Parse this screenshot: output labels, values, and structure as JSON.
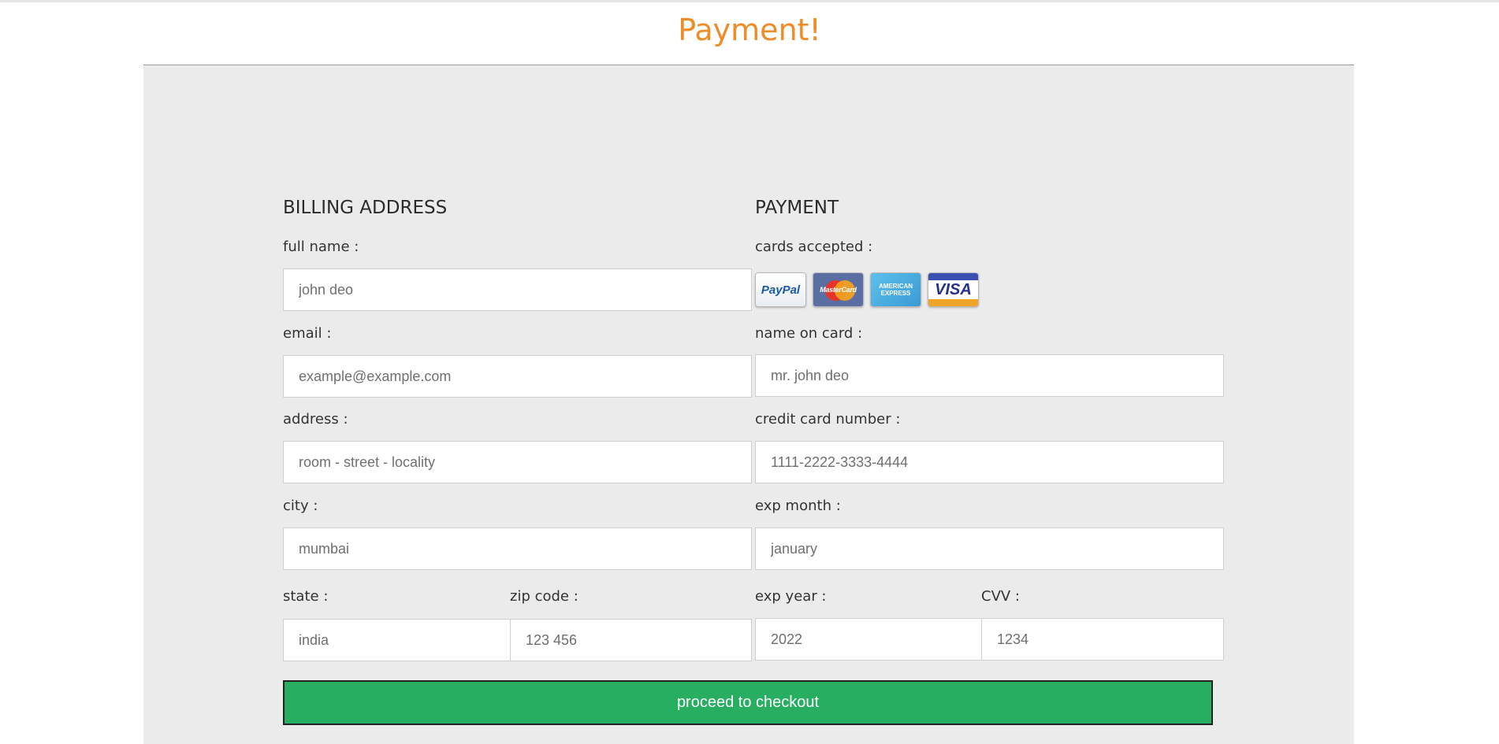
{
  "page": {
    "title": "Payment!"
  },
  "billing": {
    "heading": "BILLING ADDRESS",
    "full_name": {
      "label": "full name :",
      "placeholder": "john deo"
    },
    "email": {
      "label": "email :",
      "placeholder": "example@example.com"
    },
    "address": {
      "label": "address :",
      "placeholder": "room - street - locality"
    },
    "city": {
      "label": "city :",
      "placeholder": "mumbai"
    },
    "state": {
      "label": "state :",
      "placeholder": "india"
    },
    "zip": {
      "label": "zip code :",
      "placeholder": "123 456"
    }
  },
  "payment": {
    "heading": "PAYMENT",
    "cards_label": "cards accepted :",
    "cards": [
      {
        "name": "paypal",
        "text": "PayPal"
      },
      {
        "name": "mastercard",
        "text": "MasterCard"
      },
      {
        "name": "american-express",
        "text": "AMERICAN EXPRESS"
      },
      {
        "name": "visa",
        "text": "VISA"
      }
    ],
    "name_on_card": {
      "label": "name on card :",
      "placeholder": "mr. john deo"
    },
    "card_number": {
      "label": "credit card number :",
      "placeholder": "1111-2222-3333-4444"
    },
    "exp_month": {
      "label": "exp month :",
      "placeholder": "january"
    },
    "exp_year": {
      "label": "exp year :",
      "placeholder": "2022"
    },
    "cvv": {
      "label": "CVV :",
      "placeholder": "1234"
    }
  },
  "checkout": {
    "label": "proceed to checkout",
    "color": "#27ae60"
  },
  "colors": {
    "title": "#f08c28",
    "panel": "#ebebeb"
  }
}
